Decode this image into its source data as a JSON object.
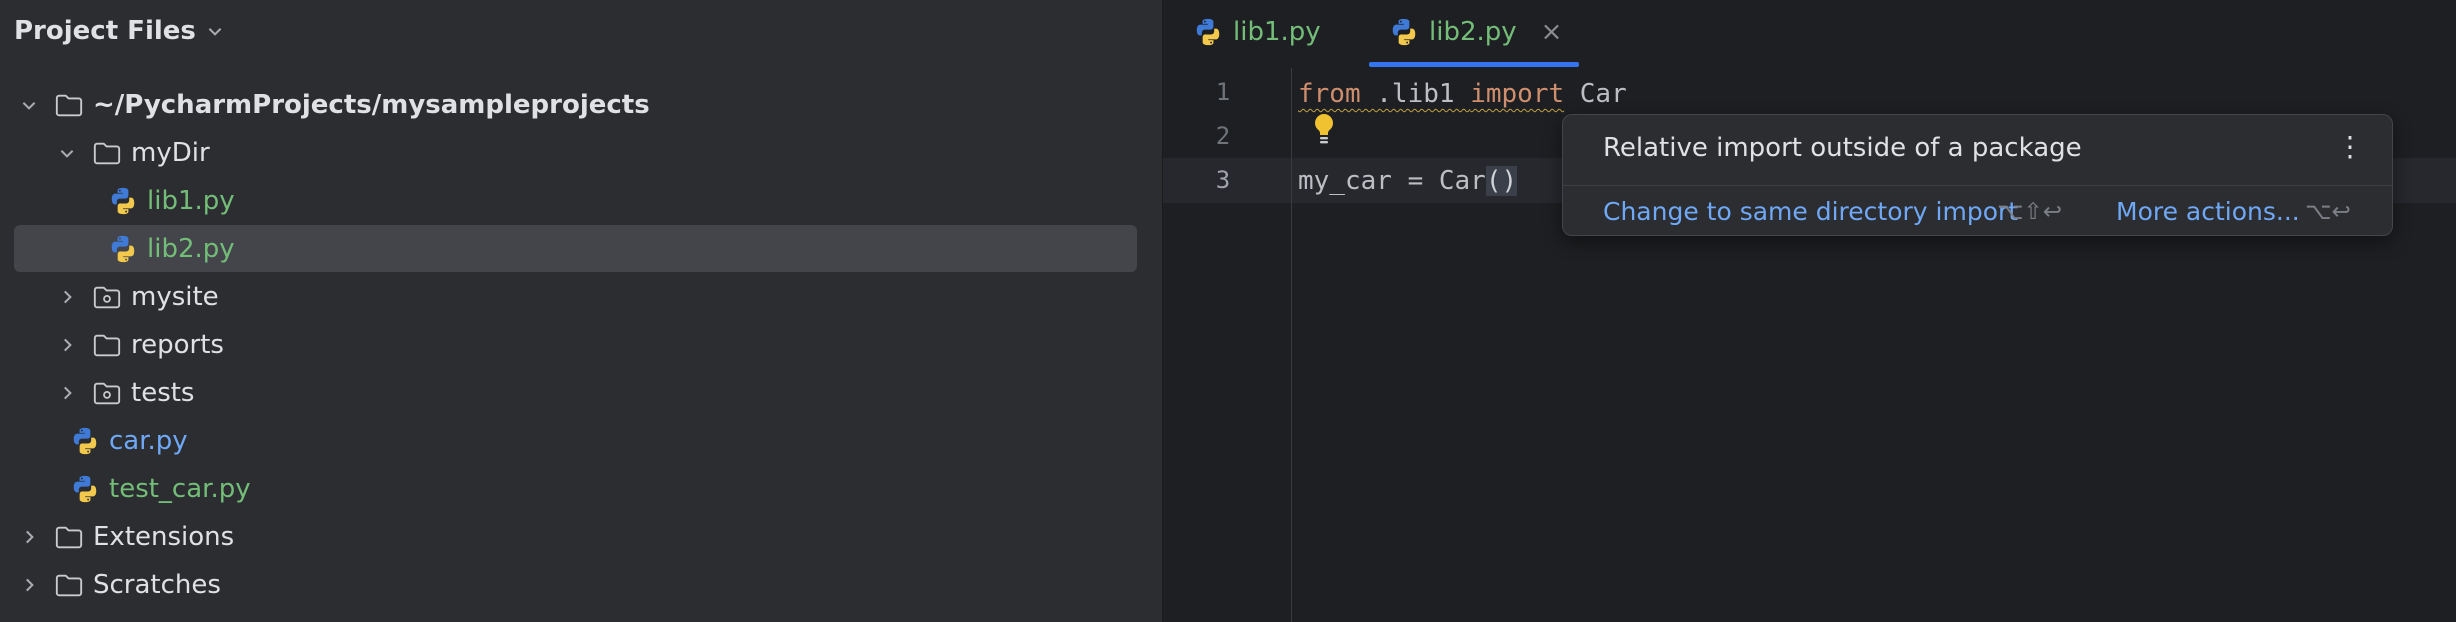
{
  "project": {
    "header_title": "Project Files",
    "tree": [
      {
        "label": "~/PycharmProjects/mysampleprojects",
        "type": "folder",
        "expanded": true,
        "depth": 0,
        "style": "bold"
      },
      {
        "label": "myDir",
        "type": "folder",
        "expanded": true,
        "depth": 1,
        "style": "normal"
      },
      {
        "label": "lib1.py",
        "type": "python",
        "depth": 2,
        "style": "green"
      },
      {
        "label": "lib2.py",
        "type": "python",
        "depth": 2,
        "style": "green",
        "selected": true
      },
      {
        "label": "mysite",
        "type": "module-folder",
        "expanded": false,
        "depth": 1,
        "style": "normal"
      },
      {
        "label": "reports",
        "type": "folder",
        "expanded": false,
        "depth": 1,
        "style": "normal"
      },
      {
        "label": "tests",
        "type": "module-folder",
        "expanded": false,
        "depth": 1,
        "style": "normal"
      },
      {
        "label": "car.py",
        "type": "python",
        "depth": 1,
        "style": "blue"
      },
      {
        "label": "test_car.py",
        "type": "python",
        "depth": 1,
        "style": "green"
      },
      {
        "label": "Extensions",
        "type": "folder",
        "expanded": false,
        "depth": 0,
        "style": "normal"
      },
      {
        "label": "Scratches",
        "type": "folder",
        "expanded": false,
        "depth": 0,
        "style": "normal"
      }
    ]
  },
  "editor": {
    "tabs": [
      {
        "label": "lib1.py",
        "active": false
      },
      {
        "label": "lib2.py",
        "active": true,
        "close_glyph": "×"
      }
    ],
    "line_numbers": [
      "1",
      "2",
      "3"
    ],
    "code": {
      "line1": {
        "kw1": "from",
        "mod": " .lib1 ",
        "kw2": "import",
        "rest": " Car"
      },
      "line3": {
        "text": "my_car = Car",
        "parens": "()"
      }
    }
  },
  "popup": {
    "title": "Relative import outside of a package",
    "menu_glyph": "⋮",
    "primary_action": "Change to same directory import",
    "primary_shortcut": "⌥⇧↩",
    "more_action": "More actions...",
    "more_shortcut": "⌥↩"
  },
  "colors": {
    "accent": "#3574f0",
    "keyword": "#cf8e6d",
    "file_green": "#73bd79",
    "file_blue": "#6fa8f7",
    "warning": "#c4a043"
  },
  "icons": {
    "header_chevron": "chevron-down-icon",
    "folder": "folder-icon",
    "module_folder": "module-folder-icon",
    "python_file": "python-file-icon",
    "bulb": "lightbulb-icon"
  }
}
